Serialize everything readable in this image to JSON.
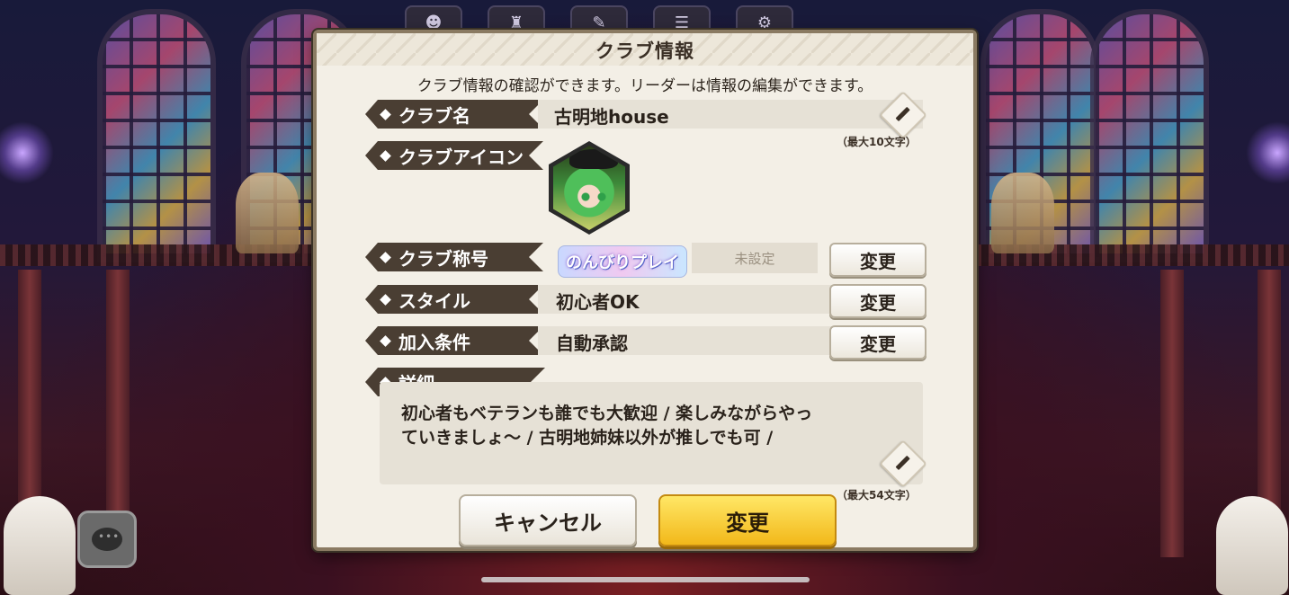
{
  "top_icons": [
    "character-icon",
    "castle-icon",
    "wrench-icon",
    "checklist-icon",
    "gear-icon"
  ],
  "dialog": {
    "title": "クラブ情報",
    "description": "クラブ情報の確認ができます。リーダーは情報の編集ができます。",
    "club_name": {
      "label": "クラブ名",
      "value": "古明地house",
      "limit": "（最大10文字）"
    },
    "club_icon": {
      "label": "クラブアイコン"
    },
    "club_title": {
      "label": "クラブ称号",
      "badge_text": "のんびりプレイ",
      "status": "未設定",
      "button": "変更"
    },
    "style": {
      "label": "スタイル",
      "value": "初心者OK",
      "button": "変更"
    },
    "join_condition": {
      "label": "加入条件",
      "value": "自動承認",
      "button": "変更"
    },
    "details": {
      "label": "詳細",
      "line1": "初心者もベテランも誰でも大歓迎 /  楽しみながらやっ",
      "line2": "ていきましょ～ / 古明地姉妹以外が推しでも可 /",
      "limit": "（最大54文字）"
    },
    "cancel_button": "キャンセル",
    "confirm_button": "変更"
  },
  "colors": {
    "label_bg": "#4a3e33",
    "dialog_bg": "#f3efe6",
    "confirm_button": "#f2b81a"
  }
}
